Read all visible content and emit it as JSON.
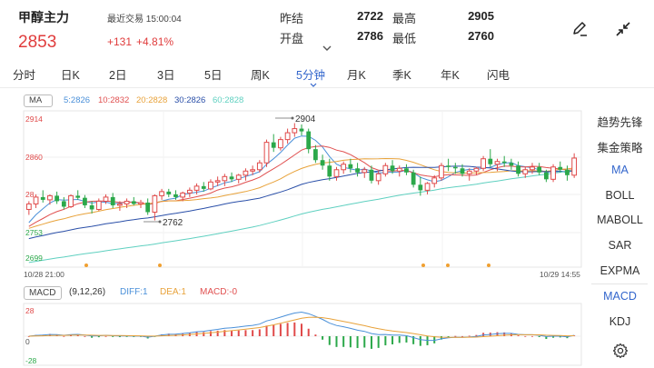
{
  "symbol": {
    "name": "甲醇主力",
    "last_trade": "最近交易 15:00:04",
    "price": "2853",
    "change": "+131",
    "change_pct": "+4.81%"
  },
  "quote": {
    "prev_settle_label": "昨结",
    "prev_settle": "2722",
    "open_label": "开盘",
    "open": "2786",
    "high_label": "最高",
    "high": "2905",
    "low_label": "最低",
    "low": "2760",
    "expand_icon": "chevron-down-icon"
  },
  "header_icons": {
    "draw": "pen-draw-icon",
    "collapse": "collapse-arrows-icon"
  },
  "tabs": [
    {
      "label": "分时"
    },
    {
      "label": "日K"
    },
    {
      "label": "2日"
    },
    {
      "label": "3日"
    },
    {
      "label": "5日"
    },
    {
      "label": "周K"
    },
    {
      "label": "5分钟",
      "active": true
    },
    {
      "label": "月K"
    },
    {
      "label": "季K"
    },
    {
      "label": "年K"
    },
    {
      "label": "闪电"
    }
  ],
  "ma": {
    "label": "MA",
    "items": [
      {
        "text": "5:2826",
        "color": "#4a90d9"
      },
      {
        "text": "10:2832",
        "color": "#e05050"
      },
      {
        "text": "20:2828",
        "color": "#e8a23a"
      },
      {
        "text": "30:2826",
        "color": "#2a4fa8"
      },
      {
        "text": "60:2828",
        "color": "#5fd0c0"
      }
    ]
  },
  "chart_data": {
    "type": "candlestick",
    "price_axis": {
      "top": "2914",
      "mid": "2860",
      "side": "28",
      "bottom": "2753",
      "lowest": "2699",
      "range": [
        2699,
        2914
      ]
    },
    "annotations": {
      "high": "2904",
      "low": "2762"
    },
    "x_labels": {
      "start": "10/28 21:00",
      "end": "10/29 14:55"
    },
    "macd_axis": {
      "top": "28",
      "mid": "0",
      "bottom": "-28"
    },
    "candles": [
      [
        2778,
        2790,
        2770,
        2786
      ],
      [
        2786,
        2800,
        2780,
        2796
      ],
      [
        2796,
        2806,
        2788,
        2792
      ],
      [
        2792,
        2800,
        2785,
        2798
      ],
      [
        2798,
        2804,
        2786,
        2790
      ],
      [
        2790,
        2796,
        2778,
        2782
      ],
      [
        2782,
        2800,
        2780,
        2798
      ],
      [
        2798,
        2806,
        2792,
        2795
      ],
      [
        2795,
        2799,
        2780,
        2784
      ],
      [
        2784,
        2790,
        2772,
        2778
      ],
      [
        2778,
        2794,
        2776,
        2790
      ],
      [
        2790,
        2800,
        2786,
        2796
      ],
      [
        2796,
        2802,
        2780,
        2784
      ],
      [
        2784,
        2790,
        2776,
        2786
      ],
      [
        2786,
        2794,
        2780,
        2790
      ],
      [
        2790,
        2796,
        2784,
        2786
      ],
      [
        2786,
        2792,
        2780,
        2788
      ],
      [
        2788,
        2794,
        2770,
        2774
      ],
      [
        2774,
        2800,
        2762,
        2798
      ],
      [
        2798,
        2808,
        2792,
        2804
      ],
      [
        2804,
        2808,
        2796,
        2800
      ],
      [
        2800,
        2806,
        2792,
        2796
      ],
      [
        2796,
        2804,
        2790,
        2802
      ],
      [
        2802,
        2810,
        2796,
        2806
      ],
      [
        2806,
        2816,
        2800,
        2812
      ],
      [
        2812,
        2818,
        2804,
        2808
      ],
      [
        2808,
        2822,
        2806,
        2818
      ],
      [
        2818,
        2826,
        2812,
        2820
      ],
      [
        2820,
        2830,
        2812,
        2826
      ],
      [
        2826,
        2832,
        2818,
        2822
      ],
      [
        2822,
        2830,
        2816,
        2828
      ],
      [
        2828,
        2838,
        2820,
        2834
      ],
      [
        2834,
        2842,
        2828,
        2836
      ],
      [
        2836,
        2850,
        2832,
        2846
      ],
      [
        2846,
        2880,
        2840,
        2876
      ],
      [
        2876,
        2888,
        2862,
        2868
      ],
      [
        2868,
        2884,
        2864,
        2880
      ],
      [
        2880,
        2896,
        2874,
        2890
      ],
      [
        2890,
        2904,
        2884,
        2896
      ],
      [
        2896,
        2902,
        2886,
        2892
      ],
      [
        2892,
        2896,
        2860,
        2866
      ],
      [
        2866,
        2872,
        2846,
        2850
      ],
      [
        2850,
        2858,
        2836,
        2842
      ],
      [
        2842,
        2852,
        2820,
        2826
      ],
      [
        2826,
        2840,
        2820,
        2836
      ],
      [
        2836,
        2848,
        2830,
        2844
      ],
      [
        2844,
        2852,
        2832,
        2838
      ],
      [
        2838,
        2846,
        2826,
        2832
      ],
      [
        2832,
        2840,
        2824,
        2836
      ],
      [
        2836,
        2842,
        2816,
        2820
      ],
      [
        2820,
        2834,
        2814,
        2830
      ],
      [
        2830,
        2846,
        2826,
        2842
      ],
      [
        2842,
        2850,
        2830,
        2834
      ],
      [
        2834,
        2842,
        2826,
        2838
      ],
      [
        2838,
        2844,
        2828,
        2832
      ],
      [
        2832,
        2836,
        2810,
        2814
      ],
      [
        2814,
        2826,
        2798,
        2806
      ],
      [
        2806,
        2818,
        2800,
        2816
      ],
      [
        2816,
        2828,
        2810,
        2824
      ],
      [
        2824,
        2846,
        2820,
        2842
      ],
      [
        2842,
        2852,
        2834,
        2840
      ],
      [
        2840,
        2846,
        2830,
        2838
      ],
      [
        2838,
        2844,
        2826,
        2830
      ],
      [
        2830,
        2838,
        2820,
        2834
      ],
      [
        2834,
        2840,
        2828,
        2838
      ],
      [
        2838,
        2856,
        2834,
        2852
      ],
      [
        2852,
        2866,
        2840,
        2844
      ],
      [
        2844,
        2852,
        2834,
        2848
      ],
      [
        2848,
        2856,
        2840,
        2846
      ],
      [
        2846,
        2852,
        2836,
        2842
      ],
      [
        2842,
        2848,
        2826,
        2830
      ],
      [
        2830,
        2840,
        2824,
        2836
      ],
      [
        2836,
        2846,
        2830,
        2840
      ],
      [
        2840,
        2846,
        2828,
        2832
      ],
      [
        2832,
        2836,
        2818,
        2822
      ],
      [
        2822,
        2844,
        2818,
        2840
      ],
      [
        2840,
        2848,
        2832,
        2836
      ],
      [
        2836,
        2842,
        2820,
        2828
      ],
      [
        2828,
        2860,
        2824,
        2853
      ]
    ],
    "macd_params": "(9,12,26)",
    "diff_label": "DIFF:1",
    "dea_label": "DEA:1",
    "macd_label": "MACD:-0"
  },
  "side_menu": [
    {
      "label": "趋势先锋"
    },
    {
      "label": "集金策略"
    },
    {
      "label": "MA",
      "active": true
    },
    {
      "label": "BOLL"
    },
    {
      "label": "MABOLL"
    },
    {
      "label": "SAR"
    },
    {
      "label": "EXPMA"
    },
    {
      "label": "MACD",
      "active": true
    },
    {
      "label": "KDJ"
    }
  ],
  "settings_icon": "gear-icon",
  "macd": {
    "label": "MACD"
  },
  "colors": {
    "up": "#e04a4a",
    "down": "#2ba84a",
    "accent": "#3366cc"
  }
}
